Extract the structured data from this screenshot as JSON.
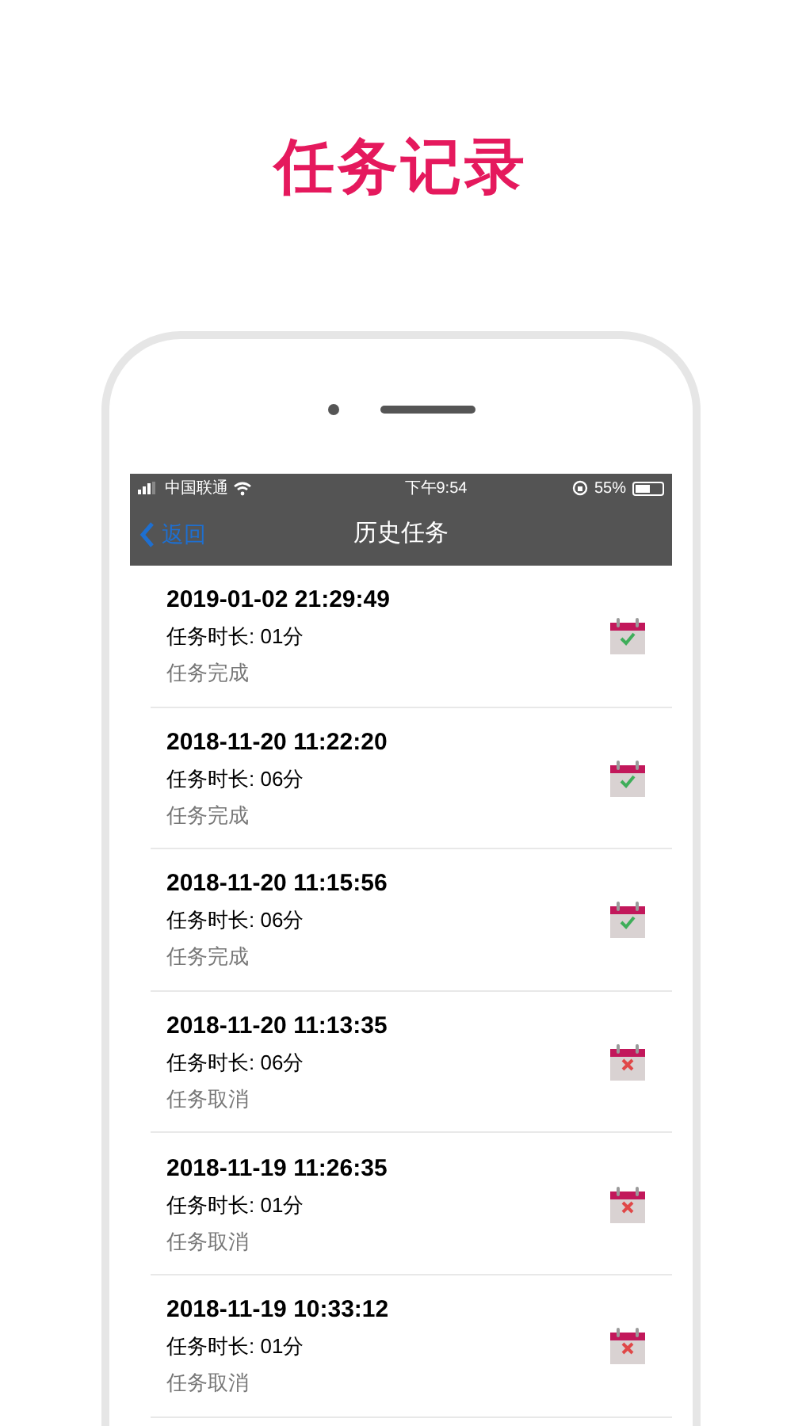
{
  "headline": "任务记录",
  "status_bar": {
    "carrier": "中国联通",
    "time": "下午9:54",
    "battery": {
      "text": "55%",
      "level": 0.55
    }
  },
  "nav": {
    "back": "返回",
    "title": "历史任务"
  },
  "tasks": [
    {
      "time": "2019-01-02 21:29:49",
      "duration": "任务时长: 01分",
      "status": "任务完成",
      "kind": "completed"
    },
    {
      "time": "2018-11-20 11:22:20",
      "duration": "任务时长: 06分",
      "status": "任务完成",
      "kind": "completed"
    },
    {
      "time": "2018-11-20 11:15:56",
      "duration": "任务时长: 06分",
      "status": "任务完成",
      "kind": "completed"
    },
    {
      "time": "2018-11-20 11:13:35",
      "duration": "任务时长: 06分",
      "status": "任务取消",
      "kind": "cancelled"
    },
    {
      "time": "2018-11-19 11:26:35",
      "duration": "任务时长: 01分",
      "status": "任务取消",
      "kind": "cancelled"
    },
    {
      "time": "2018-11-19 10:33:12",
      "duration": "任务时长: 01分",
      "status": "任务取消",
      "kind": "cancelled"
    }
  ]
}
